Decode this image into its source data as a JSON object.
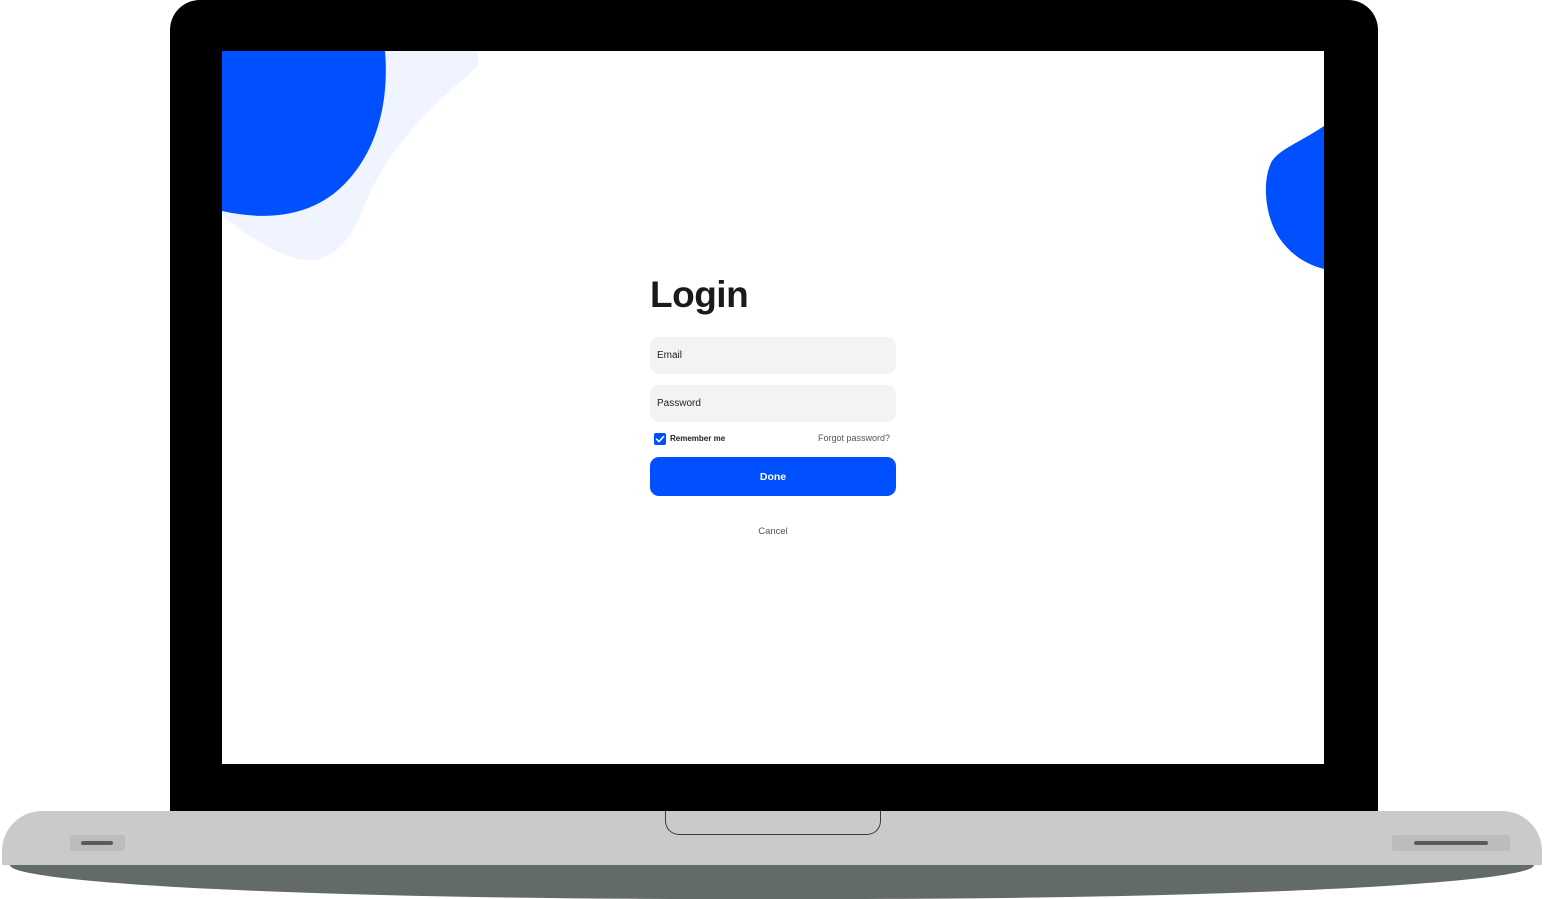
{
  "login": {
    "title": "Login",
    "email_placeholder": "Email",
    "password_placeholder": "Password",
    "remember_me_label": "Remember me",
    "remember_me_checked": true,
    "forgot_password_label": "Forgot password?",
    "done_label": "Done",
    "cancel_label": "Cancel"
  },
  "colors": {
    "accent": "#0050ff",
    "accent_light": "#f0f4ff",
    "field_bg": "#f3f3f3",
    "title_text": "#1a1a1a",
    "laptop_frame": "#000000",
    "laptop_base": "#cacaca",
    "laptop_base_bottom": "#636b69"
  },
  "icons": {
    "checkbox": "checkmark-icon"
  }
}
